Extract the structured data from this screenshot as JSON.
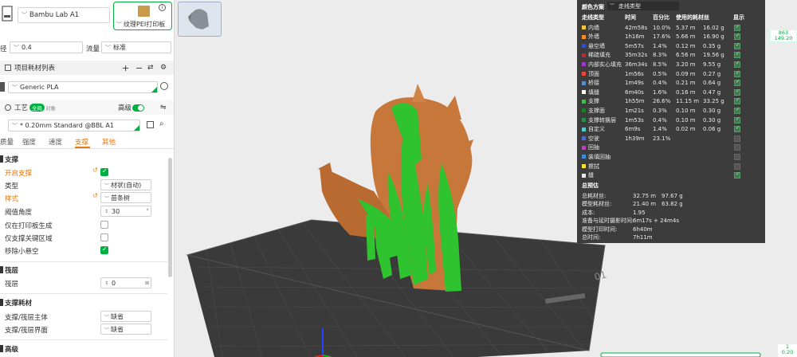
{
  "printer": {
    "name": "Bambu Lab A1",
    "plate_type": "纹理PEI打印板",
    "info_icon": "info-icon"
  },
  "nozzle": {
    "label": "径",
    "value": "0.4",
    "flow_label": "流量",
    "flow_value": "标准"
  },
  "filaments": {
    "title": "项目耗材列表",
    "item": "Generic PLA"
  },
  "process": {
    "title": "工艺",
    "toggle_all": "全局",
    "toggle_object": "对象",
    "advanced": "高级",
    "preset": "* 0.20mm Standard @BBL A1"
  },
  "tabs": [
    "质量",
    "强度",
    "速度",
    "支撑",
    "其他"
  ],
  "support": {
    "section": "支撑",
    "enable_label": "开启支撑",
    "type_label": "类型",
    "type_value": "材状(自动)",
    "style_label": "样式",
    "style_value": "苗条树",
    "threshold_label": "阈值角度",
    "threshold_value": "30",
    "threshold_unit": "°",
    "build_plate_only": "仅在打印板生成",
    "critical_only": "仅支撑关键区域",
    "remove_small": "移除小悬空"
  },
  "raft": {
    "section": "筏层",
    "layers_label": "筏层",
    "layers_value": "0"
  },
  "support_filament": {
    "section": "支撑耗材",
    "base_label": "支撑/筏层主体",
    "base_value": "缺省",
    "interface_label": "支撑/筏层界面",
    "interface_value": "缺省"
  },
  "advanced_section": "高级",
  "stats": {
    "scheme_label": "颜色方案",
    "scheme_value": "走线类型",
    "headers": [
      "走线类型",
      "时间",
      "百分比",
      "使用的耗材丝",
      "显示"
    ],
    "rows": [
      {
        "name": "内墙",
        "color": "#f5c342",
        "time": "42m58s",
        "pct": "10.0%",
        "len": "5.37 m",
        "wt": "16.02 g",
        "show": true
      },
      {
        "name": "外墙",
        "color": "#f08c2a",
        "time": "1h16m",
        "pct": "17.6%",
        "len": "5.66 m",
        "wt": "16.90 g",
        "show": true
      },
      {
        "name": "悬空墙",
        "color": "#2b4fd8",
        "time": "5m57s",
        "pct": "1.4%",
        "len": "0.12 m",
        "wt": "0.35 g",
        "show": true
      },
      {
        "name": "稀疏填充",
        "color": "#b0313a",
        "time": "35m32s",
        "pct": "8.3%",
        "len": "6.56 m",
        "wt": "19.56 g",
        "show": true
      },
      {
        "name": "内部实心填充",
        "color": "#9b3cc8",
        "time": "36m34s",
        "pct": "8.5%",
        "len": "3.20 m",
        "wt": "9.55 g",
        "show": true
      },
      {
        "name": "顶面",
        "color": "#e84a3a",
        "time": "1m56s",
        "pct": "0.5%",
        "len": "0.09 m",
        "wt": "0.27 g",
        "show": true
      },
      {
        "name": "桥接",
        "color": "#5a8fc8",
        "time": "1m49s",
        "pct": "0.4%",
        "len": "0.21 m",
        "wt": "0.64 g",
        "show": true
      },
      {
        "name": "填缝",
        "color": "#ffffff",
        "time": "6m40s",
        "pct": "1.6%",
        "len": "0.16 m",
        "wt": "0.47 g",
        "show": true
      },
      {
        "name": "支撑",
        "color": "#35c43c",
        "time": "1h55m",
        "pct": "26.6%",
        "len": "11.15 m",
        "wt": "33.25 g",
        "show": true
      },
      {
        "name": "支撑面",
        "color": "#1f7a2a",
        "time": "1m21s",
        "pct": "0.3%",
        "len": "0.10 m",
        "wt": "0.30 g",
        "show": true
      },
      {
        "name": "支撑转换层",
        "color": "#2a8a4a",
        "time": "1m53s",
        "pct": "0.4%",
        "len": "0.10 m",
        "wt": "0.30 g",
        "show": true
      },
      {
        "name": "自定义",
        "color": "#5fc7c9",
        "time": "6m9s",
        "pct": "1.4%",
        "len": "0.02 m",
        "wt": "0.06 g",
        "show": true
      },
      {
        "name": "空驶",
        "color": "#4a6bd8",
        "time": "1h39m",
        "pct": "23.1%",
        "len": "",
        "wt": "",
        "show": false
      },
      {
        "name": "回抽",
        "color": "#c43cc4",
        "time": "",
        "pct": "",
        "len": "",
        "wt": "",
        "show": false
      },
      {
        "name": "装填回抽",
        "color": "#3c8ad8",
        "time": "",
        "pct": "",
        "len": "",
        "wt": "",
        "show": false
      },
      {
        "name": "擦拭",
        "color": "#f5e03c",
        "time": "",
        "pct": "",
        "len": "",
        "wt": "",
        "show": false
      },
      {
        "name": "缝",
        "color": "#e8e8e8",
        "time": "",
        "pct": "",
        "len": "",
        "wt": "",
        "show": true
      }
    ],
    "summary_title": "总预估",
    "summary": [
      {
        "label": "总耗材丝:",
        "v1": "32.75 m",
        "v2": "97.67 g"
      },
      {
        "label": "模型耗材丝:",
        "v1": "21.40 m",
        "v2": "63.82 g"
      },
      {
        "label": "成本:",
        "v1": "1.95",
        "v2": ""
      },
      {
        "label": "准备与延时摄影时间:",
        "v1": "6m17s + 24m4s",
        "v2": ""
      },
      {
        "label": "模型打印时间:",
        "v1": "6h40m",
        "v2": ""
      },
      {
        "label": "总时间:",
        "v1": "7h11m",
        "v2": ""
      }
    ]
  },
  "layer_slider": {
    "top_layer": "863",
    "top_height": "149.20",
    "bottom_layer": "1",
    "bottom_height": "0.20"
  },
  "colors": {
    "accent": "#00ae42",
    "orange": "#e8770d",
    "model": "#c8773a",
    "support": "#2fc32f"
  }
}
